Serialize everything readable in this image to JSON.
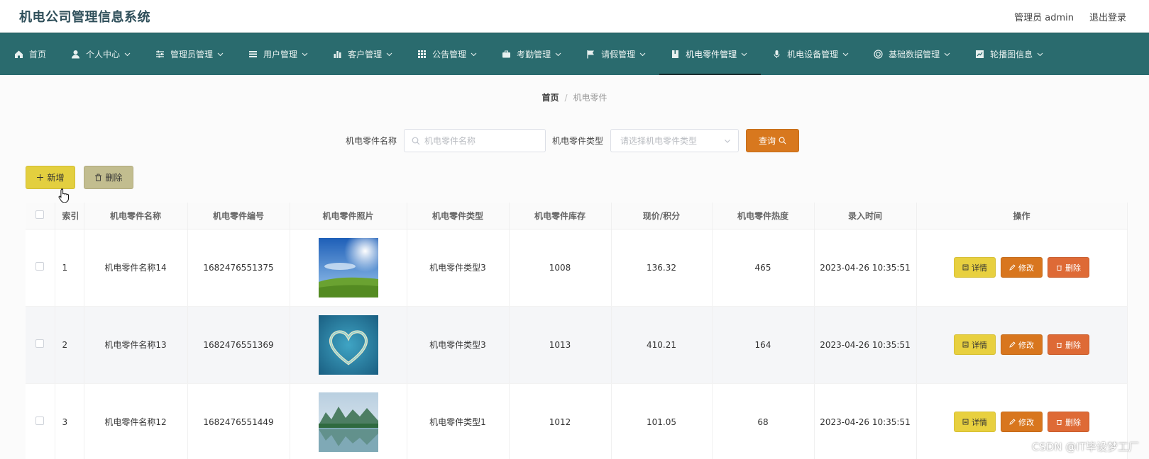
{
  "app": {
    "title": "机电公司管理信息系统"
  },
  "header": {
    "user": "管理员 admin",
    "logout": "退出登录"
  },
  "nav": {
    "items": [
      {
        "label": "首页",
        "icon": "home-icon",
        "dropdown": false
      },
      {
        "label": "个人中心",
        "icon": "user-icon",
        "dropdown": true
      },
      {
        "label": "管理员管理",
        "icon": "sliders-icon",
        "dropdown": true
      },
      {
        "label": "用户管理",
        "icon": "list-icon",
        "dropdown": true
      },
      {
        "label": "客户管理",
        "icon": "bar-chart-icon",
        "dropdown": true
      },
      {
        "label": "公告管理",
        "icon": "grid-icon",
        "dropdown": true
      },
      {
        "label": "考勤管理",
        "icon": "briefcase-icon",
        "dropdown": true
      },
      {
        "label": "请假管理",
        "icon": "flag-icon",
        "dropdown": true
      },
      {
        "label": "机电零件管理",
        "icon": "book-icon",
        "dropdown": true,
        "active": true
      },
      {
        "label": "机电设备管理",
        "icon": "microphone-icon",
        "dropdown": true
      },
      {
        "label": "基础数据管理",
        "icon": "target-icon",
        "dropdown": true
      },
      {
        "label": "轮播图信息",
        "icon": "chart-icon",
        "dropdown": true
      }
    ]
  },
  "breadcrumb": {
    "home": "首页",
    "sep": "/",
    "current": "机电零件"
  },
  "search": {
    "name_label": "机电零件名称",
    "name_placeholder": "机电零件名称",
    "type_label": "机电零件类型",
    "type_placeholder": "请选择机电零件类型",
    "query_label": "查询"
  },
  "actions": {
    "add_label": "新增",
    "delete_label": "删除"
  },
  "table": {
    "columns": [
      "索引",
      "机电零件名称",
      "机电零件编号",
      "机电零件照片",
      "机电零件类型",
      "机电零件库存",
      "现价/积分",
      "机电零件热度",
      "录入时间",
      "操作"
    ],
    "rows": [
      {
        "index": "1",
        "name": "机电零件名称14",
        "code": "1682476551375",
        "photo": "sky-field",
        "type": "机电零件类型3",
        "stock": "1008",
        "price": "136.32",
        "heat": "465",
        "time": "2023-04-26 10:35:51"
      },
      {
        "index": "2",
        "name": "机电零件名称13",
        "code": "1682476551369",
        "photo": "heart-island",
        "type": "机电零件类型3",
        "stock": "1013",
        "price": "410.21",
        "heat": "164",
        "time": "2023-04-26 10:35:51"
      },
      {
        "index": "3",
        "name": "机电零件名称12",
        "code": "1682476551449",
        "photo": "lake-mountains",
        "type": "机电零件类型1",
        "stock": "1012",
        "price": "101.05",
        "heat": "68",
        "time": "2023-04-26 10:35:51"
      }
    ],
    "op_labels": {
      "detail": "详情",
      "edit": "修改",
      "delete": "删除"
    }
  },
  "watermark": "CSDN @IT毕设梦工厂",
  "colors": {
    "nav_bg": "#2a6b6e",
    "query": "#d8781e",
    "add": "#e3cf3f",
    "delete": "#c2bd8f",
    "op_detail": "#e8d03f",
    "op_edit": "#d8761e",
    "op_delete": "#de6a36"
  }
}
